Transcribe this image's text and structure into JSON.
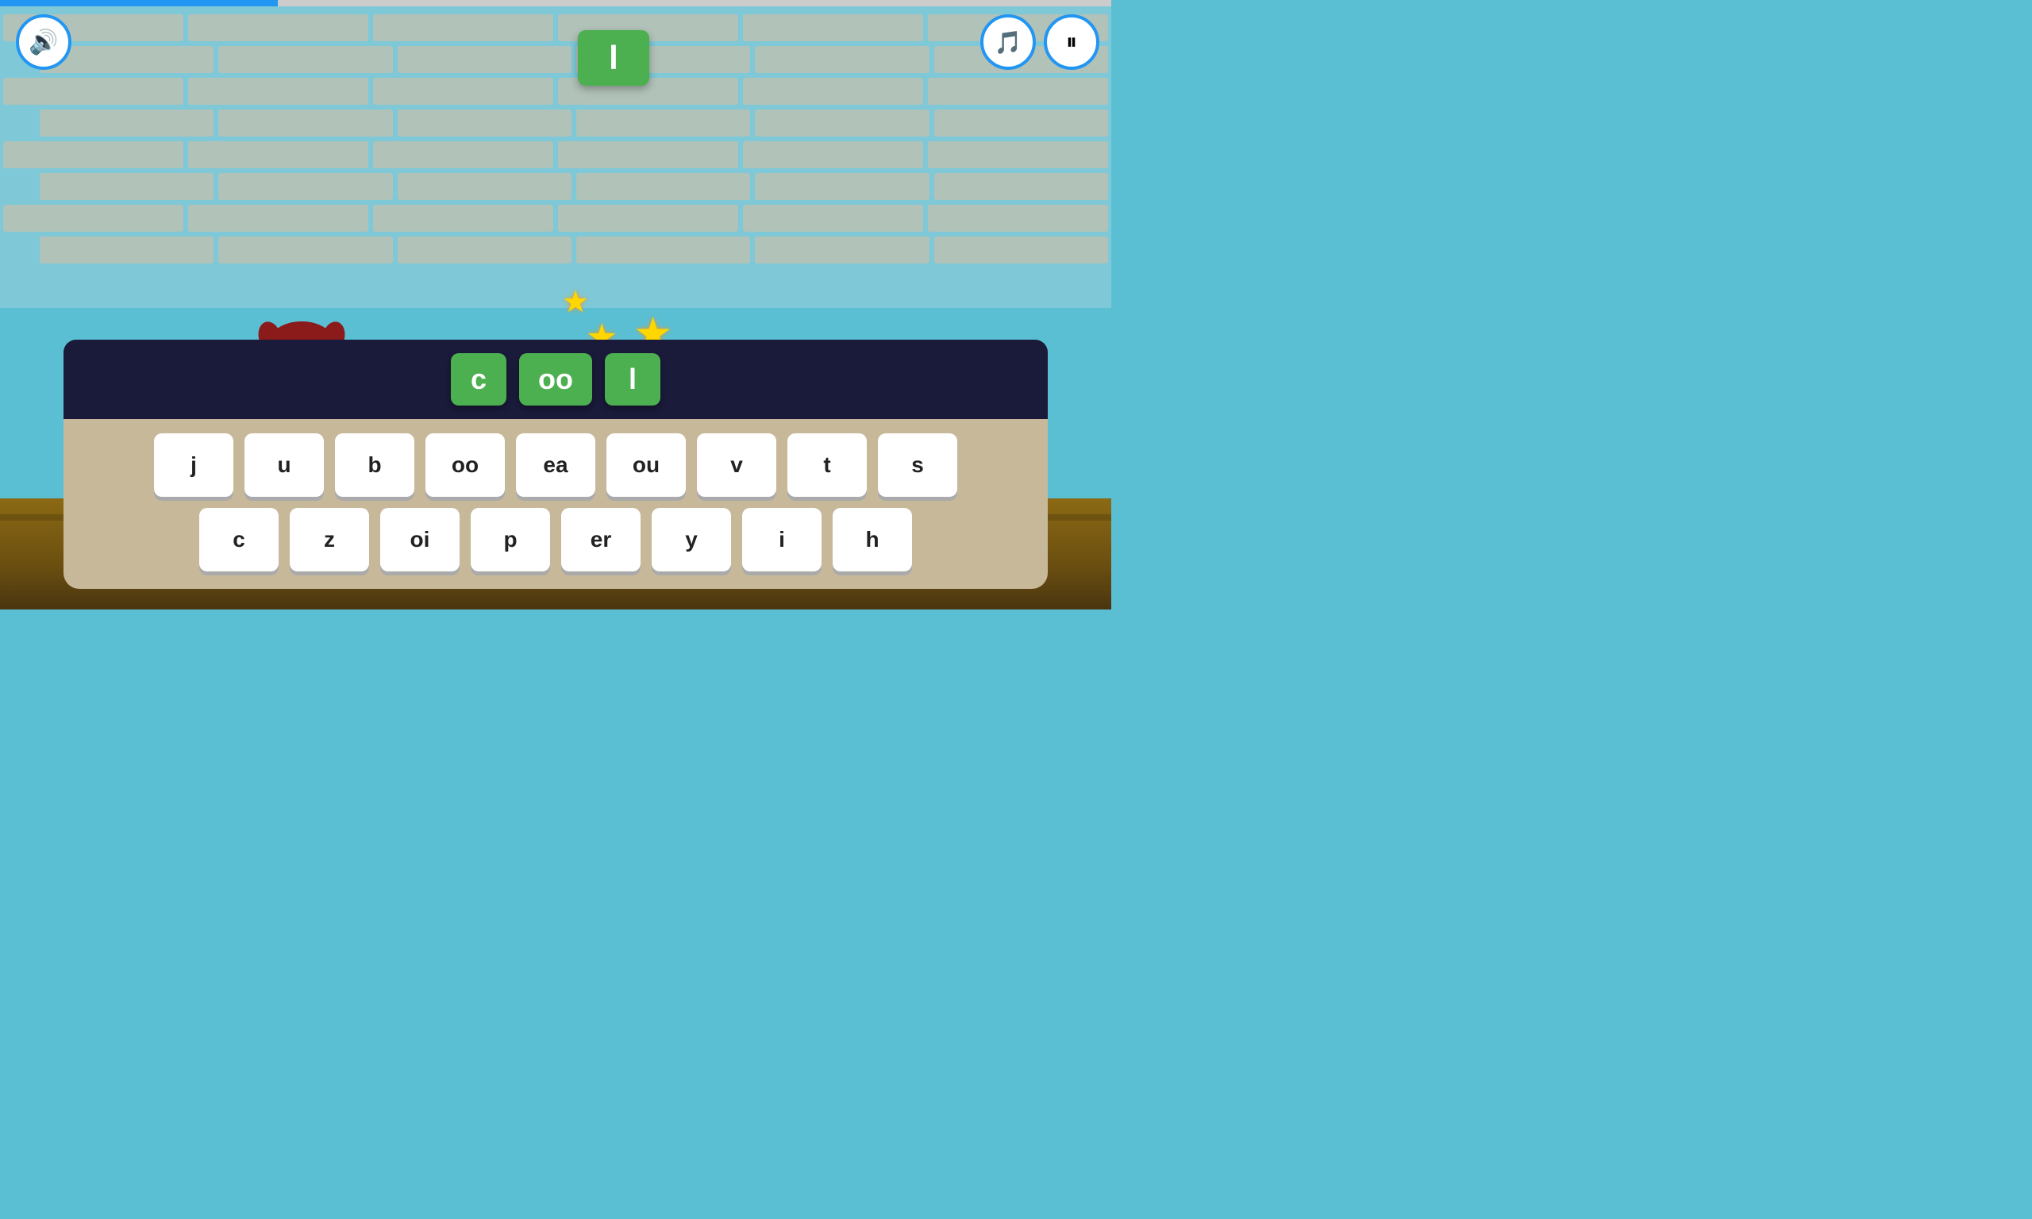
{
  "progressBar": {
    "fillPercent": 25
  },
  "controls": {
    "sound_label": "🔊",
    "music_label": "🎵",
    "pause_label": "⏸"
  },
  "floatingLetter": {
    "letter": "l"
  },
  "wordBar": {
    "tiles": [
      "c",
      "oo",
      "l"
    ]
  },
  "keyboard": {
    "row1": [
      "j",
      "u",
      "b",
      "oo",
      "ea",
      "ou",
      "v",
      "t",
      "s"
    ],
    "row2": [
      "c",
      "z",
      "oi",
      "p",
      "er",
      "y",
      "i",
      "h"
    ]
  },
  "stars": [
    "★",
    "★",
    "★",
    "★",
    "★",
    "★",
    "★",
    "★"
  ]
}
